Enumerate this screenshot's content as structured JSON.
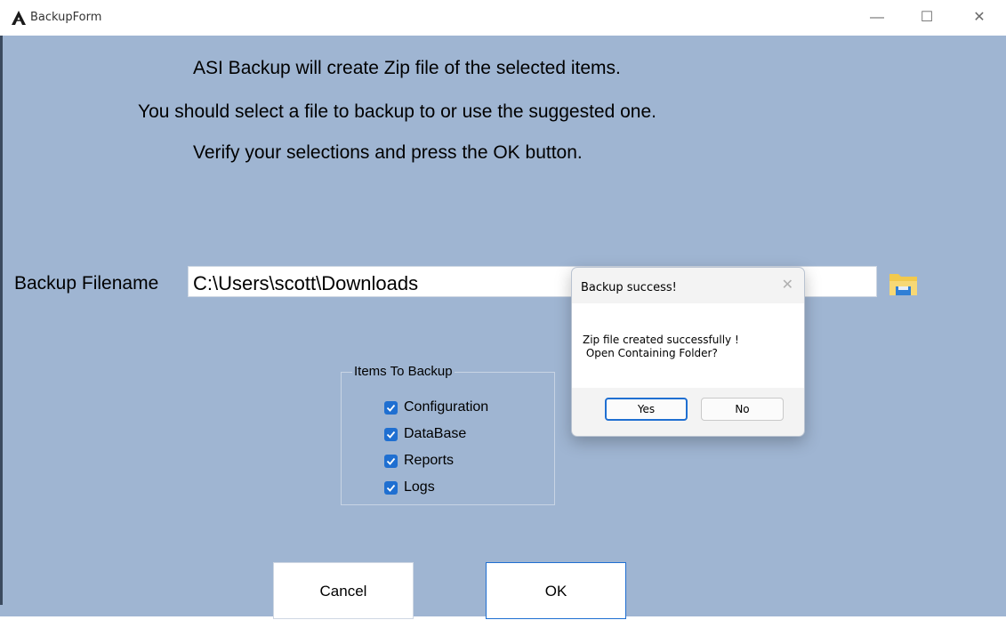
{
  "window": {
    "title": "BackupForm",
    "minimize_glyph": "—",
    "maximize_glyph": "☐",
    "close_glyph": "✕"
  },
  "instructions": [
    "ASI Backup will create Zip file of the selected items.",
    "You should select a file to backup to or use the suggested one.",
    "Verify your selections and press the OK button."
  ],
  "filename": {
    "label": "Backup Filename",
    "value": "C:\\Users\\scott\\Downloads",
    "browse_icon": "folder-icon"
  },
  "items_group": {
    "title": "Items To Backup",
    "items": [
      {
        "label": "Configuration",
        "checked": true
      },
      {
        "label": "DataBase",
        "checked": true
      },
      {
        "label": "Reports",
        "checked": true
      },
      {
        "label": "Logs",
        "checked": true
      }
    ]
  },
  "buttons": {
    "cancel": "Cancel",
    "ok": "OK"
  },
  "dialog": {
    "title": "Backup success!",
    "close_glyph": "✕",
    "message_line1": "Zip file created successfully !",
    "message_line2": " Open Containing Folder?",
    "yes": "Yes",
    "no": "No"
  },
  "colors": {
    "form_background": "#9fb5d2",
    "checkbox_accent": "#1f6fd1",
    "folder_icon": "#f2c94c"
  }
}
